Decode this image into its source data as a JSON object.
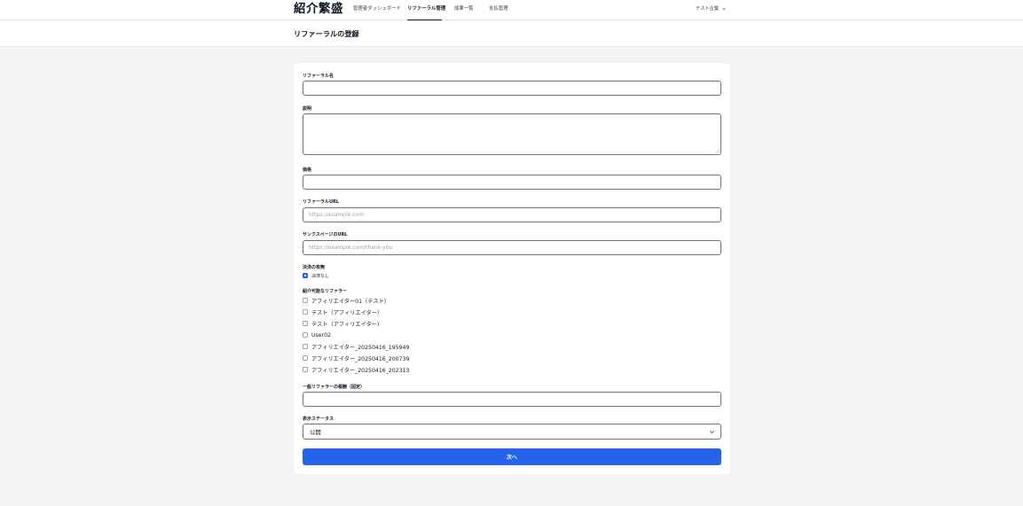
{
  "app": {
    "logo": "紹介繁盛"
  },
  "nav": {
    "items": [
      {
        "label": "管理者ダッシュボード",
        "active": false
      },
      {
        "label": "リファーラル管理",
        "active": true
      },
      {
        "label": "成果一覧",
        "active": false
      },
      {
        "label": "支払管理",
        "active": false
      }
    ],
    "user": "テスト企業"
  },
  "page": {
    "title": "リファーラルの登録"
  },
  "form": {
    "referral_name": {
      "label": "リファーラル名",
      "value": ""
    },
    "description": {
      "label": "説明",
      "value": ""
    },
    "price": {
      "label": "価格",
      "value": ""
    },
    "referral_url": {
      "label": "リファーラルURL",
      "placeholder": "https://example.com"
    },
    "thanks_url": {
      "label": "サンクスページのURL",
      "placeholder": "https://example.com/thank-you"
    },
    "payment": {
      "label": "決済の有無",
      "option": {
        "label": "決済なし",
        "checked": true
      }
    },
    "referrers": {
      "label": "紹介可能なリファラー",
      "options": [
        {
          "label": "アフィリエイター01（テスト）",
          "checked": false
        },
        {
          "label": "テスト（アフィリエイター）",
          "checked": false
        },
        {
          "label": "テスト（アフィリエイター）",
          "checked": false
        },
        {
          "label": "User02",
          "checked": false
        },
        {
          "label": "アフィリエイター_20250416_195949",
          "checked": false
        },
        {
          "label": "アフィリエイター_20250416_200739",
          "checked": false
        },
        {
          "label": "アフィリエイター_20250416_202313",
          "checked": false
        }
      ]
    },
    "general_reward": {
      "label": "一般リファラーの報酬（固定）",
      "value": ""
    },
    "status": {
      "label": "表示ステータス",
      "selected": "公開"
    },
    "submit_label": "次へ"
  },
  "colors": {
    "primary": "#2563eb",
    "background": "#f3f4f6",
    "card": "#ffffff",
    "border": "#6b7280"
  }
}
